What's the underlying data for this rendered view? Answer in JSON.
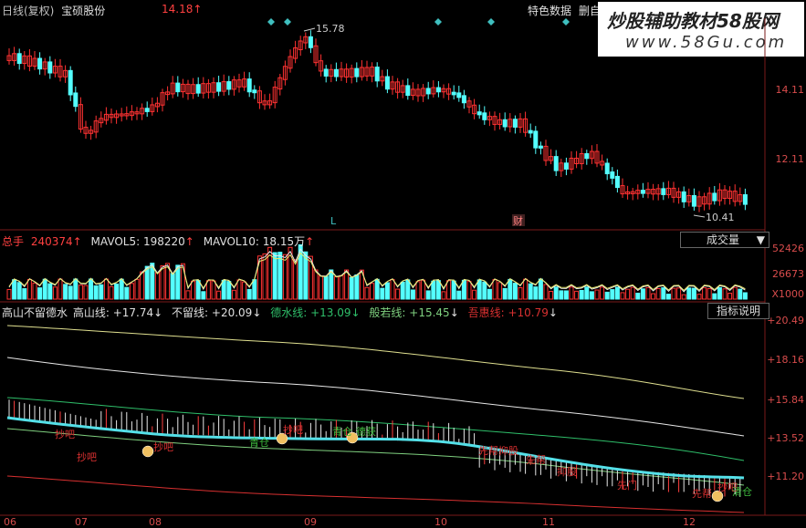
{
  "header": {
    "period": "日线(复权)",
    "stock_name": "宝硕股份",
    "price": "14.18",
    "price_arrow": "↑",
    "feature_btn": "特色数据",
    "delete_btn": "删自"
  },
  "watermark": {
    "title": "炒股辅助教材58股网",
    "url": "www.58Gu.com"
  },
  "price_axis": [
    "14.11",
    "12.11"
  ],
  "price_annotations": {
    "high": "15.78",
    "low": "10.41",
    "marker_l": "L",
    "marker_cai": "财"
  },
  "volume": {
    "label": "总手",
    "value": "240374",
    "arrow": "↑",
    "mavol5_label": "MAVOL5:",
    "mavol5_value": "198220",
    "mavol10_label": "MAVOL10:",
    "mavol10_value": "18.15万",
    "selector": "成交量",
    "axis": [
      "52426",
      "26673",
      "X1000"
    ]
  },
  "indicator": {
    "name": "高山不留德水",
    "items": [
      {
        "label": "高山线:",
        "value": "+17.74",
        "arrow": "↓",
        "color": "#e0e0e0"
      },
      {
        "label": "不留线:",
        "value": "+20.09",
        "arrow": "↓",
        "color": "#e0e0e0"
      },
      {
        "label": "德水线:",
        "value": "+13.09",
        "arrow": "↓",
        "color": "#2fbf6a"
      },
      {
        "label": "般若线:",
        "value": "+15.45",
        "arrow": "↓",
        "color": "#7fd07f"
      },
      {
        "label": "吾惠线:",
        "value": "+10.79",
        "arrow": "↓",
        "color": "#d83030"
      }
    ],
    "help_btn": "指标说明",
    "axis": [
      "+20.49",
      "+18.16",
      "+15.84",
      "+13.52",
      "+11.20"
    ],
    "signals": [
      {
        "text": "抄吧",
        "color": "#d83030"
      },
      {
        "text": "抄吧",
        "color": "#d83030"
      },
      {
        "text": "抄吧",
        "color": "#d83030"
      },
      {
        "text": "青仓",
        "color": "#3fbf3f"
      },
      {
        "text": "抄吧",
        "color": "#d83030"
      },
      {
        "text": "青仓",
        "color": "#3fbf3f"
      },
      {
        "text": "德获",
        "color": "#3fbf3f"
      },
      {
        "text": "先帮抑股",
        "color": "#d83030"
      },
      {
        "text": "先帮",
        "color": "#d83030"
      },
      {
        "text": "抑股",
        "color": "#d83030"
      },
      {
        "text": "先门",
        "color": "#d83030"
      },
      {
        "text": "先帮",
        "color": "#d83030"
      },
      {
        "text": "抄吧",
        "color": "#d83030"
      },
      {
        "text": "清仓",
        "color": "#3fbf3f"
      }
    ]
  },
  "dates": [
    "06",
    "07",
    "08",
    "09",
    "10",
    "11",
    "12"
  ],
  "colors": {
    "up": "#ff3232",
    "down": "#54ffff",
    "axis": "#7a1a1a",
    "text_red": "#d84c4c"
  }
}
